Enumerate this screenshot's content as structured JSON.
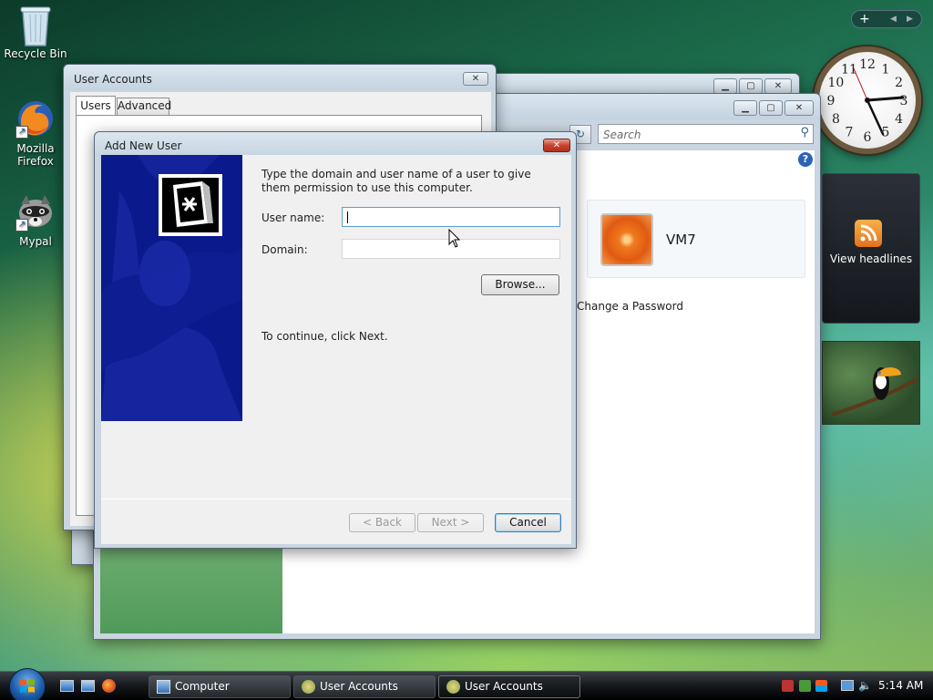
{
  "desktop": {
    "icons": [
      {
        "label": "Recycle Bin"
      },
      {
        "label": "Mozilla Firefox"
      },
      {
        "label": "Mypal"
      }
    ]
  },
  "gadgets": {
    "feed_label": "View headlines",
    "clock_numbers": [
      "12",
      "1",
      "2",
      "3",
      "4",
      "5",
      "6",
      "7",
      "8",
      "9",
      "10",
      "11"
    ]
  },
  "back_window": {
    "search_placeholder": "Search",
    "user_name": "VM7",
    "change_password": "Change a Password"
  },
  "user_accounts_dialog": {
    "title": "User Accounts",
    "tabs": [
      {
        "label": "Users"
      },
      {
        "label": "Advanced"
      }
    ]
  },
  "add_user_dialog": {
    "title": "Add New User",
    "instructions": "Type the domain and user name of a user to give them permission to use this computer.",
    "user_name_label": "User name:",
    "user_name_value": "",
    "domain_label": "Domain:",
    "domain_value": "",
    "browse_label": "Browse...",
    "continue_text": "To continue, click Next.",
    "back_label": "< Back",
    "next_label": "Next >",
    "cancel_label": "Cancel"
  },
  "taskbar": {
    "buttons": [
      {
        "label": "Computer"
      },
      {
        "label": "User Accounts"
      },
      {
        "label": "User Accounts"
      }
    ],
    "time": "5:14 AM"
  },
  "colors": {
    "dialog_art_bg": "#0a1a8c",
    "accent": "#3c7fb1"
  }
}
